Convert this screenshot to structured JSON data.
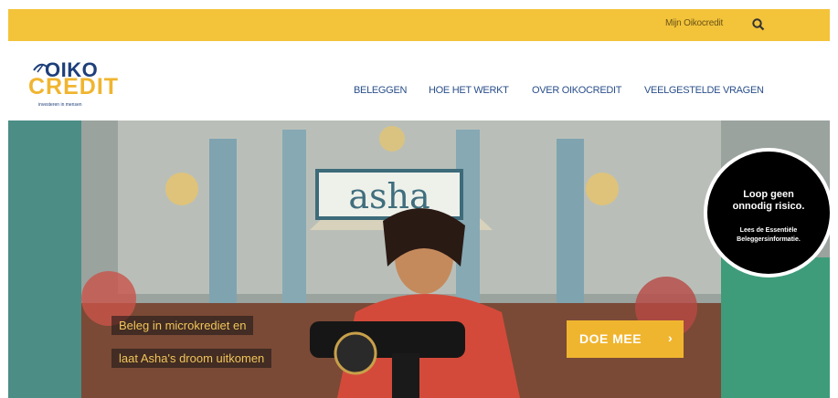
{
  "topbar": {
    "account_link": "Mijn Oikocredit",
    "search_icon": "search-icon"
  },
  "logo": {
    "line1": "OIKO",
    "line2": "CREDIT",
    "tagline": "investeren in mensen"
  },
  "nav": {
    "items": [
      "BELEGGEN",
      "HOE HET WERKT",
      "OVER OIKOCREDIT",
      "VEELGESTELDE VRAGEN"
    ]
  },
  "hero": {
    "sign": "asha",
    "caption_line1": "Beleg in microkrediet en",
    "caption_line2": "laat Asha's droom uitkomen",
    "cta_label": "DOE MEE",
    "cta_arrow": "›"
  },
  "badge": {
    "title_line1": "Loop geen",
    "title_line2": "onnodig risico.",
    "body_line1": "Lees de Essentiële",
    "body_line2": "Beleggersinformatie."
  },
  "colors": {
    "accent": "#f3c33a",
    "brand_blue": "#1e3f7a",
    "cta": "#f0b52f"
  }
}
